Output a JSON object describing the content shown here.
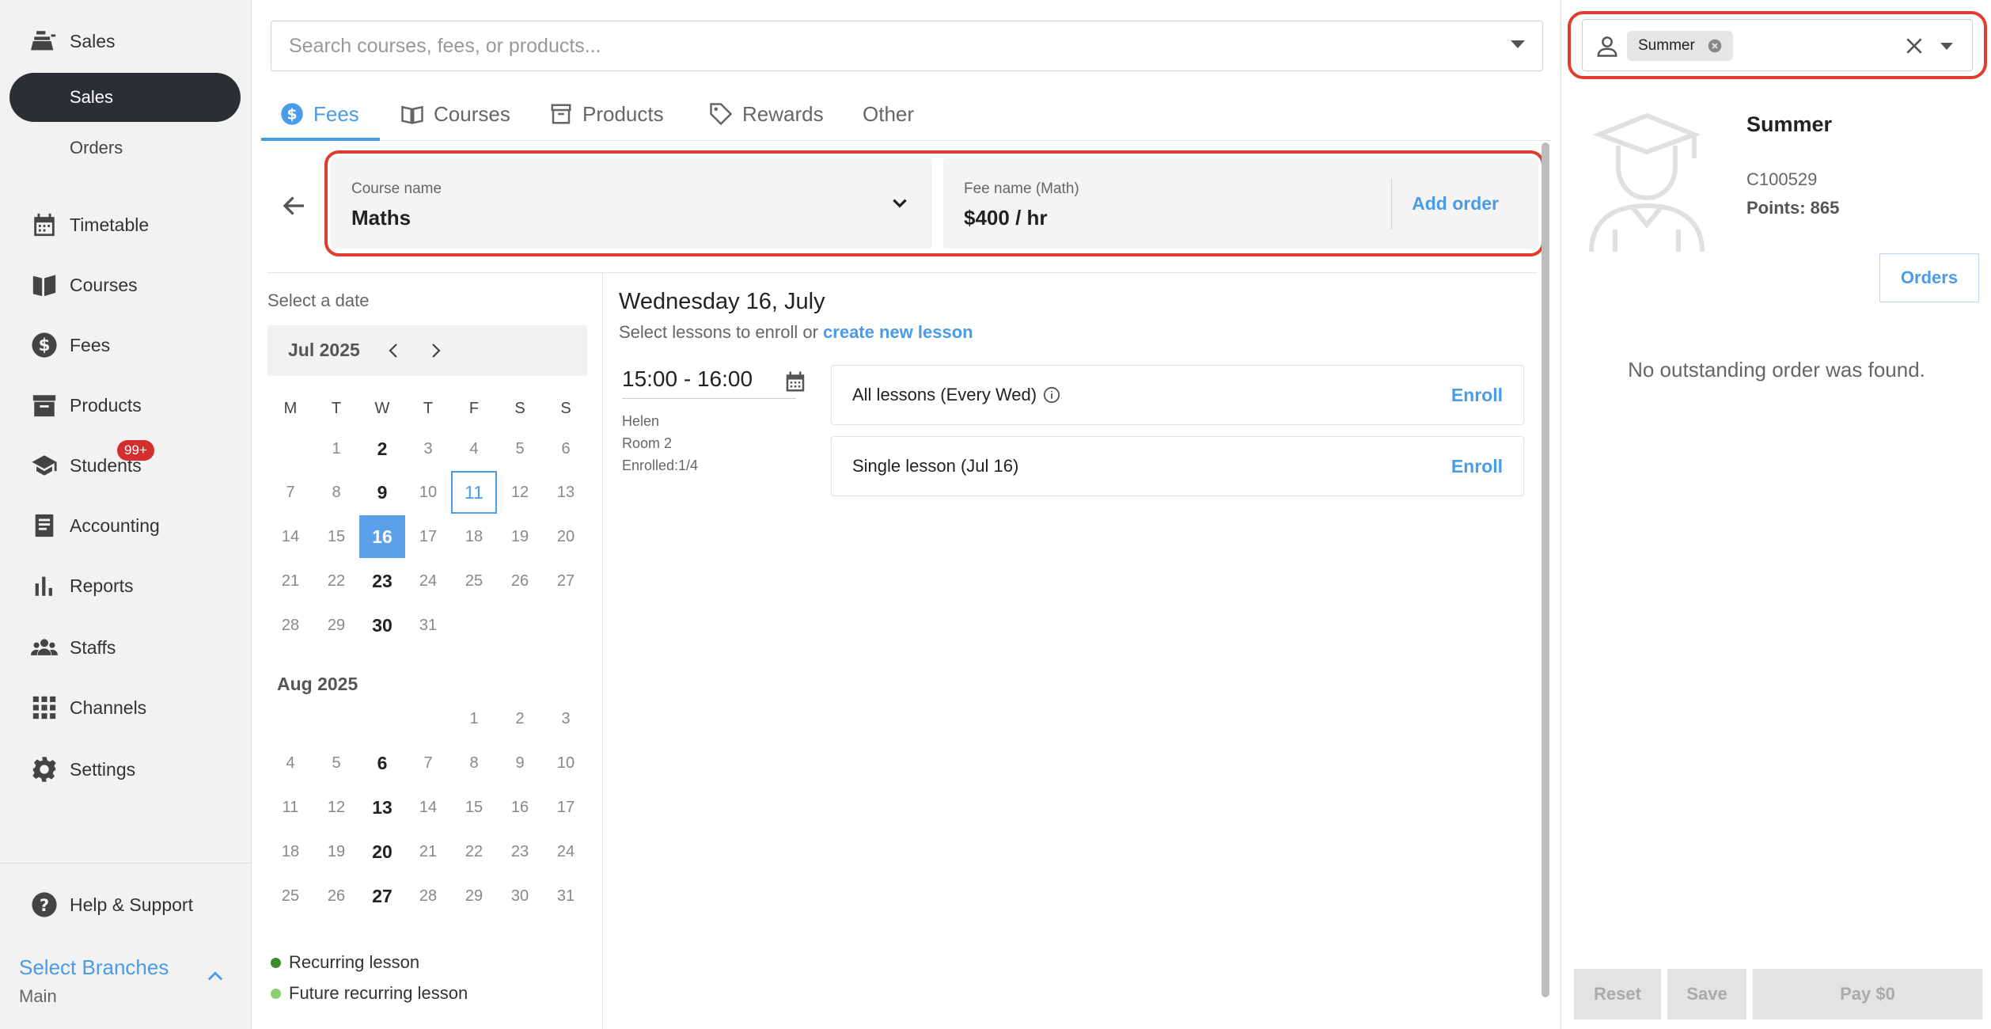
{
  "sidebar": {
    "sales_header": "Sales",
    "sales_sub": "Sales",
    "orders_sub": "Orders",
    "items": [
      "Timetable",
      "Courses",
      "Fees",
      "Products",
      "Students",
      "Accounting",
      "Reports",
      "Staffs",
      "Channels",
      "Settings"
    ],
    "students_badge": "99+",
    "help": "Help & Support",
    "branch_title": "Select Branches",
    "branch_value": "Main"
  },
  "search": {
    "placeholder": "Search courses, fees, or products..."
  },
  "tabs": [
    "Fees",
    "Courses",
    "Products",
    "Rewards",
    "Other"
  ],
  "fee_bar": {
    "course_label": "Course name",
    "course_value": "Maths",
    "fee_label": "Fee name (Math)",
    "fee_value": "$400 / hr",
    "add_order": "Add order"
  },
  "calendar": {
    "title": "Select a date",
    "month1": "Jul 2025",
    "month2": "Aug 2025",
    "weekdays": [
      "M",
      "T",
      "W",
      "T",
      "F",
      "S",
      "S"
    ],
    "legend": [
      "Recurring lesson",
      "Future recurring lesson"
    ]
  },
  "lessons": {
    "date_heading": "Wednesday 16, July",
    "sub_prefix": "Select lessons to enroll or",
    "sub_link": "create new lesson",
    "time": "15:00 - 16:00",
    "teacher": "Helen",
    "room": "Room 2",
    "enrolled": "Enrolled:1/4",
    "options": [
      {
        "name": "All lessons (Every Wed)",
        "action": "Enroll"
      },
      {
        "name": "Single lesson (Jul 16)",
        "action": "Enroll"
      }
    ]
  },
  "customer": {
    "chip": "Summer",
    "name": "Summer",
    "id": "C100529",
    "points": "Points: 865",
    "orders_btn": "Orders",
    "no_order": "No outstanding order was found."
  },
  "footer": {
    "reset": "Reset",
    "save": "Save",
    "pay": "Pay $0"
  },
  "colors": {
    "accent": "#4a9be8",
    "highlight": "#e03e2d",
    "sidebar_active": "#2b2f33",
    "badge": "#d32f2f"
  }
}
